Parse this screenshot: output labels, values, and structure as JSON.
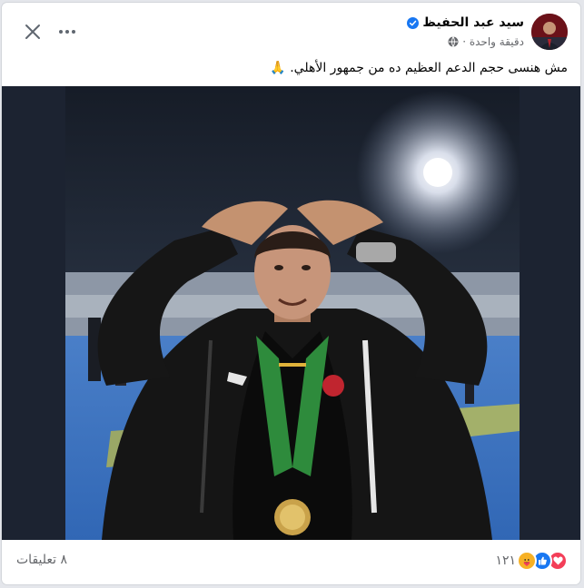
{
  "post": {
    "author": "سيد عبد الحفيظ",
    "time": "دقيقة واحدة ·",
    "text": "مش هنسى حجم الدعم العظيم ده من جمهور الأهلي. 🙏",
    "reaction_count": "١٢١",
    "comments_label": "٨ تعليقات"
  },
  "icons": {
    "verified": "verified-badge-icon",
    "audience": "globe-icon",
    "more": "more-options-icon",
    "close": "close-icon",
    "reactions": [
      "love-reaction-icon",
      "like-reaction-icon",
      "care-reaction-icon"
    ]
  },
  "colors": {
    "verified": "#1877f2",
    "love": "#f33e58",
    "like": "#1877f2",
    "care": "#f7b125",
    "text_secondary": "#65676b"
  }
}
